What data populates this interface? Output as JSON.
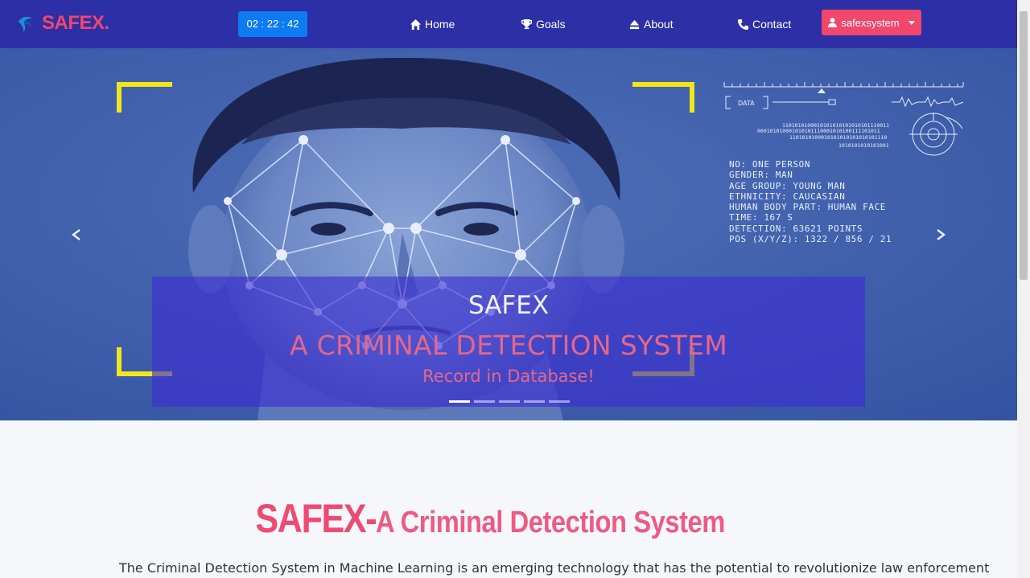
{
  "brand": {
    "name": "SAFEX."
  },
  "clock": {
    "time": "02 : 22 : 42"
  },
  "nav": {
    "home": "Home",
    "goals": "Goals",
    "about": "About",
    "contact": "Contact"
  },
  "user": {
    "name": "safexsystem"
  },
  "hud": {
    "data_label": "DATA",
    "lines": "NO: ONE PERSON\nGENDER: MAN\nAGE GROUP: YOUNG MAN\nETHNICITY: CAUCASIAN\nHUMAN BODY PART: HUMAN FACE\nTIME: 167 S\nDETECTION: 63621 POINTS\nPOS (X/Y/Z): 1322 / 856 / 21"
  },
  "carousel": {
    "title": "SAFEX",
    "subtitle": "A CRIMINAL DETECTION SYSTEM",
    "tagline": "Record in Database!",
    "slide_count": 5,
    "active_slide": 1
  },
  "content": {
    "title_main": "SAFEX-",
    "title_rest": " A Criminal Detection System",
    "paragraph": "The Criminal Detection System in Machine Learning is an emerging technology that has the potential to revolutionize law enforcement"
  },
  "colors": {
    "navbar": "#2d2fa6",
    "accent_pink": "#f0476b",
    "clock_blue": "#0d7bf2",
    "hud_yellow": "#f2e51c"
  }
}
